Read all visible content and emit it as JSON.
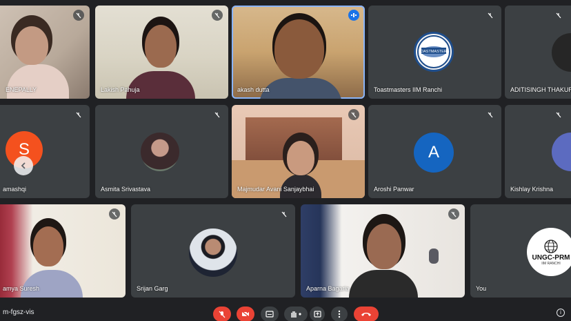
{
  "participants": {
    "enepally": "ENEPALLY",
    "lakish": "Lakish Pahuja",
    "akash": "akash dutta",
    "toastmasters": "Toastmasters IIM Ranchi",
    "aditisingh": "ADITISINGH THAKUR",
    "amashqi": "amashqi",
    "asmita": "Asmita Srivastava",
    "majmudar": "Majmudar Avani Sanjaybhai",
    "aroshi": "Aroshi Panwar",
    "kishlay": "Kishlay Krishna",
    "ramya": "amya Suresh",
    "srijan": "Srijan Garg",
    "aparna": "Aparna Bagaria",
    "you": "You"
  },
  "avatars": {
    "s_letter": "S",
    "a_letter": "A",
    "colors": {
      "s": "#f4511e",
      "a": "#1565c0",
      "k": "#5c6bc0"
    }
  },
  "logos": {
    "toastmasters_text": "TOASTMASTERS",
    "ungc_text": "UNGC-PRM",
    "ungc_sub": "IIM RANCHI"
  },
  "footer": {
    "meeting_code": "m-fgsz-vis"
  },
  "icons": {
    "mic_off": "mic-off-icon",
    "speaking": "speaking-indicator-icon",
    "prev": "chevron-left-icon",
    "info": "info-icon"
  },
  "colors": {
    "accent_blue": "#1a73e8",
    "hangup_red": "#ea4335",
    "tile_bg": "#3c4043",
    "page_bg": "#202124"
  }
}
